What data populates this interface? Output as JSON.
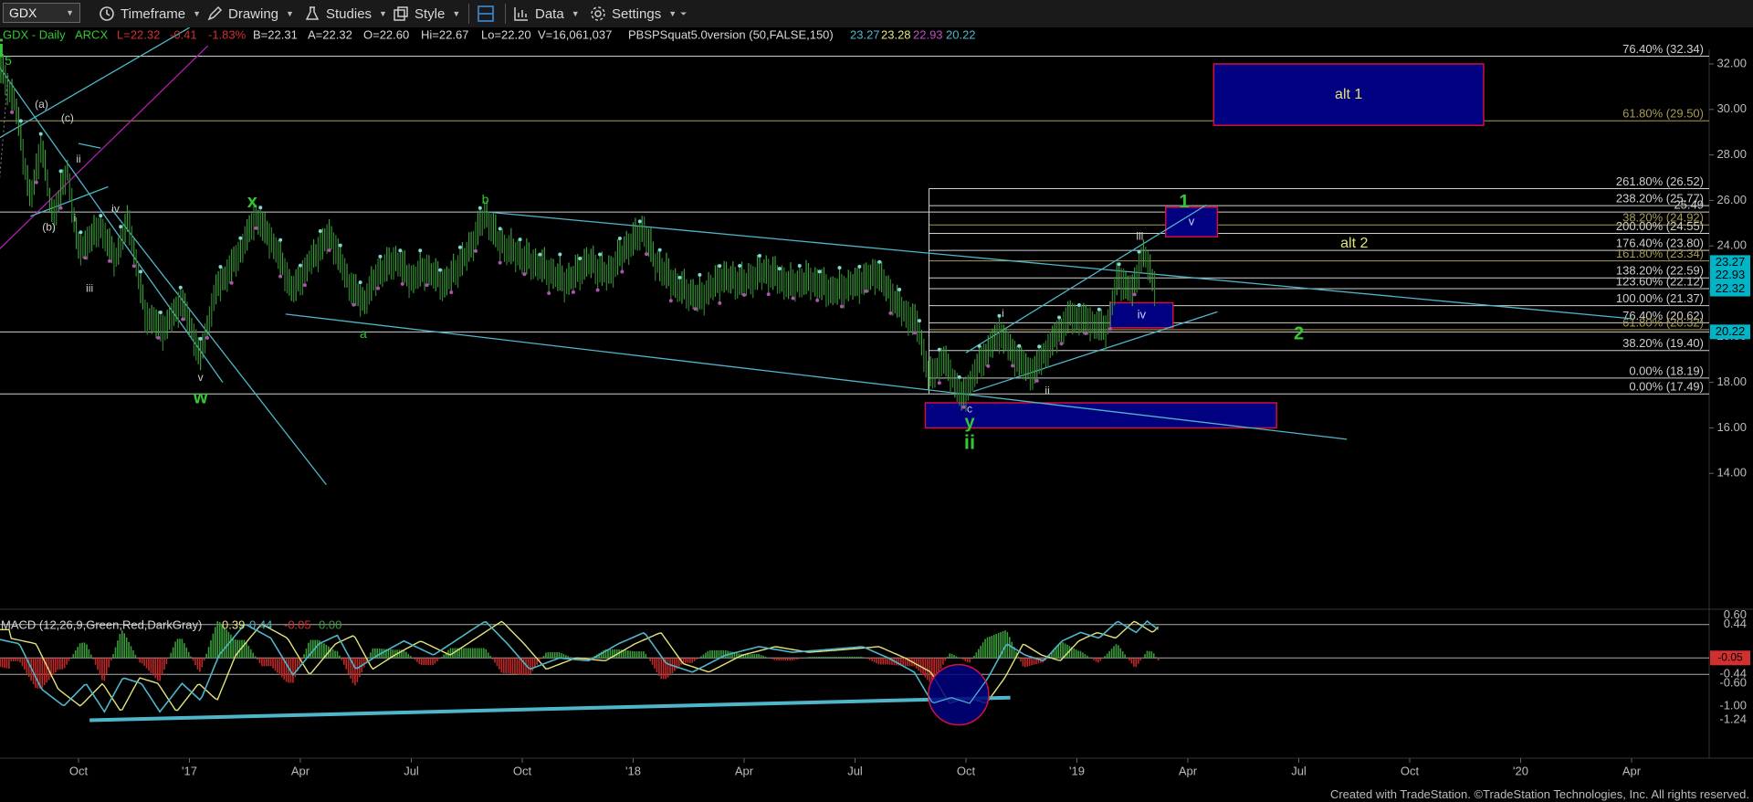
{
  "toolbar": {
    "symbol": "GDX",
    "timeframe": "Timeframe",
    "drawing": "Drawing",
    "studies": "Studies",
    "style": "Style",
    "data": "Data",
    "settings": "Settings"
  },
  "info_bar": {
    "symbol_tf": "GDX - Daily",
    "exchange": "ARCX",
    "last": "L=22.32",
    "change": "-0.41",
    "change_pct": "-1.83%",
    "bid": "B=22.31",
    "ask": "A=22.32",
    "open": "O=22.60",
    "high": "Hi=22.67",
    "low": "Lo=22.20",
    "volume": "V=16,061,037",
    "study": "PBSPSquat5.0version (50,FALSE,150)",
    "v1": "23.27",
    "v2": "23.28",
    "v3": "22.93",
    "v4": "20.22"
  },
  "colors": {
    "bull": "#3a9d3a",
    "bear": "#b050b0",
    "green_label": "#34c734",
    "channel": "#4fb6c9",
    "magenta_line": "#b01fb0",
    "box_fill": "#000080",
    "box_border": "#d01040",
    "fib": "#cfcfcf",
    "fib_gold": "#a89a55",
    "macd_line": "#4fb6c9",
    "signal_line": "#e4e47a",
    "last_price_tag": "#00b4c8"
  },
  "chart_data": {
    "type": "candlestick",
    "title": "GDX - Daily",
    "ylim": [
      13,
      33
    ],
    "y_ticks": [
      "14.00",
      "16.00",
      "18.00",
      "20.00",
      "22.00",
      "24.00",
      "26.00",
      "28.00",
      "30.00",
      "32.00"
    ],
    "x_ticks": [
      {
        "label": "Oct",
        "t": 0.0
      },
      {
        "label": "'17",
        "t": 3.0
      },
      {
        "label": "Apr",
        "t": 6.0
      },
      {
        "label": "Jul",
        "t": 9.0
      },
      {
        "label": "Oct",
        "t": 12.0
      },
      {
        "label": "'18",
        "t": 15.0
      },
      {
        "label": "Apr",
        "t": 18.0
      },
      {
        "label": "Jul",
        "t": 21.0
      },
      {
        "label": "Oct",
        "t": 24.0
      },
      {
        "label": "'19",
        "t": 27.0
      },
      {
        "label": "Apr",
        "t": 30.0
      },
      {
        "label": "Jul",
        "t": 33.0
      },
      {
        "label": "Oct",
        "t": 36.0
      },
      {
        "label": "'20",
        "t": 39.0
      },
      {
        "label": "Apr",
        "t": 42.0
      }
    ],
    "price_path": [
      {
        "t": -2.1,
        "v": 31.8
      },
      {
        "t": -1.7,
        "v": 30.2
      },
      {
        "t": -1.3,
        "v": 26.0
      },
      {
        "t": -1.0,
        "v": 28.5
      },
      {
        "t": -0.7,
        "v": 25.2
      },
      {
        "t": -0.3,
        "v": 27.3
      },
      {
        "t": 0.0,
        "v": 23.8
      },
      {
        "t": 0.6,
        "v": 24.8
      },
      {
        "t": 1.0,
        "v": 23.4
      },
      {
        "t": 1.35,
        "v": 25.2
      },
      {
        "t": 1.8,
        "v": 21.0
      },
      {
        "t": 2.3,
        "v": 20.3
      },
      {
        "t": 2.8,
        "v": 21.6
      },
      {
        "t": 3.3,
        "v": 19.1
      },
      {
        "t": 3.7,
        "v": 22.0
      },
      {
        "t": 4.3,
        "v": 23.5
      },
      {
        "t": 4.8,
        "v": 25.3
      },
      {
        "t": 5.3,
        "v": 24.0
      },
      {
        "t": 5.8,
        "v": 22.0
      },
      {
        "t": 6.3,
        "v": 23.4
      },
      {
        "t": 6.8,
        "v": 24.5
      },
      {
        "t": 7.3,
        "v": 22.4
      },
      {
        "t": 7.7,
        "v": 21.5
      },
      {
        "t": 8.1,
        "v": 22.8
      },
      {
        "t": 8.6,
        "v": 23.4
      },
      {
        "t": 9.0,
        "v": 22.5
      },
      {
        "t": 9.4,
        "v": 23.0
      },
      {
        "t": 9.9,
        "v": 22.3
      },
      {
        "t": 10.5,
        "v": 23.6
      },
      {
        "t": 11.0,
        "v": 25.4
      },
      {
        "t": 11.4,
        "v": 24.1
      },
      {
        "t": 12.0,
        "v": 23.5
      },
      {
        "t": 12.6,
        "v": 23.0
      },
      {
        "t": 13.2,
        "v": 22.4
      },
      {
        "t": 13.8,
        "v": 23.3
      },
      {
        "t": 14.3,
        "v": 22.7
      },
      {
        "t": 14.8,
        "v": 23.9
      },
      {
        "t": 15.3,
        "v": 24.7
      },
      {
        "t": 15.6,
        "v": 23.3
      },
      {
        "t": 16.2,
        "v": 22.2
      },
      {
        "t": 16.8,
        "v": 21.7
      },
      {
        "t": 17.4,
        "v": 22.6
      },
      {
        "t": 18.0,
        "v": 22.4
      },
      {
        "t": 18.6,
        "v": 22.9
      },
      {
        "t": 19.2,
        "v": 22.3
      },
      {
        "t": 19.8,
        "v": 22.5
      },
      {
        "t": 20.4,
        "v": 22.0
      },
      {
        "t": 21.0,
        "v": 22.3
      },
      {
        "t": 21.6,
        "v": 22.8
      },
      {
        "t": 22.2,
        "v": 21.3
      },
      {
        "t": 22.7,
        "v": 20.5
      },
      {
        "t": 23.0,
        "v": 18.2
      },
      {
        "t": 23.4,
        "v": 19.0
      },
      {
        "t": 23.9,
        "v": 17.3
      },
      {
        "t": 24.4,
        "v": 18.9
      },
      {
        "t": 24.9,
        "v": 20.2
      },
      {
        "t": 25.4,
        "v": 19.0
      },
      {
        "t": 25.8,
        "v": 18.4
      },
      {
        "t": 26.3,
        "v": 19.7
      },
      {
        "t": 26.8,
        "v": 20.9
      },
      {
        "t": 27.3,
        "v": 20.7
      },
      {
        "t": 27.8,
        "v": 20.3
      },
      {
        "t": 28.1,
        "v": 22.6
      },
      {
        "t": 28.5,
        "v": 22.0
      },
      {
        "t": 28.8,
        "v": 23.7
      },
      {
        "t": 29.1,
        "v": 22.3
      }
    ],
    "fib_levels": [
      {
        "label": "76.40% (32.34)",
        "value": 32.34,
        "t0": -2.3,
        "color": "fib"
      },
      {
        "label": "61.80% (29.50)",
        "value": 29.5,
        "t0": -2.3,
        "color": "fib_gold"
      },
      {
        "label": "261.80% (26.52)",
        "value": 26.52,
        "t0": 23.0,
        "color": "fib"
      },
      {
        "label": "238.20% (25.77)",
        "value": 25.77,
        "t0": 23.0,
        "color": "fib"
      },
      {
        "label": "25.49",
        "value": 25.49,
        "t0": -2.3,
        "color": "fib"
      },
      {
        "label": "38.20% (24.92)",
        "value": 24.92,
        "t0": 23.0,
        "color": "fib_gold"
      },
      {
        "label": "200.00% (24.55)",
        "value": 24.55,
        "t0": 23.0,
        "color": "fib"
      },
      {
        "label": "176.40% (23.80)",
        "value": 23.8,
        "t0": 23.0,
        "color": "fib"
      },
      {
        "label": "161.80% (23.34)",
        "value": 23.34,
        "t0": 23.0,
        "color": "fib_gold"
      },
      {
        "label": "138.20% (22.59)",
        "value": 22.59,
        "t0": 23.0,
        "color": "fib"
      },
      {
        "label": "123.60% (22.12)",
        "value": 22.12,
        "t0": 23.0,
        "color": "fib"
      },
      {
        "label": "100.00% (21.37)",
        "value": 21.37,
        "t0": 23.0,
        "color": "fib"
      },
      {
        "label": "76.40% (20.62)",
        "value": 20.62,
        "t0": 23.0,
        "color": "fib"
      },
      {
        "label": "61.80% (20.32)",
        "value": 20.32,
        "t0": 23.0,
        "color": "fib_gold"
      },
      {
        "label": "",
        "value": 20.22,
        "t0": -2.3,
        "color": "fib"
      },
      {
        "label": "38.20% (19.40)",
        "value": 19.4,
        "t0": 23.0,
        "color": "fib"
      },
      {
        "label": "0.00% (18.19)",
        "value": 18.19,
        "t0": 23.0,
        "color": "fib"
      },
      {
        "label": "0.00% (17.49)",
        "value": 17.49,
        "t0": -2.3,
        "color": "fib"
      }
    ],
    "boxes": [
      {
        "label": "alt 1",
        "t0": 30.7,
        "t1": 38.0,
        "v0": 29.3,
        "v1": 32.0
      },
      {
        "label": "v",
        "t0": 29.4,
        "t1": 30.8,
        "v0": 24.4,
        "v1": 25.7
      },
      {
        "label": "iv",
        "t0": 27.9,
        "t1": 29.6,
        "v0": 20.4,
        "v1": 21.5
      },
      {
        "label": "",
        "t0": 22.9,
        "t1": 32.4,
        "v0": 16.0,
        "v1": 17.1
      }
    ],
    "wave_labels": [
      {
        "text": "i",
        "t": -2.1,
        "v": 32.6,
        "color": "green_label",
        "size": 28,
        "bold": true
      },
      {
        "text": "5",
        "t": -1.9,
        "v": 32.1,
        "color": "green_label",
        "size": 14
      },
      {
        "text": "(a)",
        "t": -1.0,
        "v": 30.2,
        "color": "fib",
        "size": 12
      },
      {
        "text": "(c)",
        "t": -0.3,
        "v": 29.6,
        "color": "fib",
        "size": 12
      },
      {
        "text": "ii",
        "t": 0.0,
        "v": 27.8,
        "color": "fib",
        "size": 12
      },
      {
        "text": "iv",
        "t": 1.0,
        "v": 25.6,
        "color": "fib",
        "size": 12
      },
      {
        "text": "(b)",
        "t": -0.8,
        "v": 24.8,
        "color": "fib",
        "size": 12
      },
      {
        "text": "i",
        "t": -0.1,
        "v": 25.2,
        "color": "fib",
        "size": 12
      },
      {
        "text": "iii",
        "t": 0.3,
        "v": 22.1,
        "color": "fib",
        "size": 12
      },
      {
        "text": "v",
        "t": 3.3,
        "v": 18.2,
        "color": "fib",
        "size": 12
      },
      {
        "text": "w",
        "t": 3.3,
        "v": 17.3,
        "color": "green_label",
        "size": 20,
        "bold": true
      },
      {
        "text": "x",
        "t": 4.7,
        "v": 25.9,
        "color": "green_label",
        "size": 20,
        "bold": true
      },
      {
        "text": "b",
        "t": 11.0,
        "v": 26.0,
        "color": "green_label",
        "size": 14
      },
      {
        "text": "a",
        "t": 7.7,
        "v": 20.1,
        "color": "green_label",
        "size": 14
      },
      {
        "text": "i",
        "t": 25.0,
        "v": 21.0,
        "color": "fib",
        "size": 12
      },
      {
        "text": "ii",
        "t": 26.2,
        "v": 17.6,
        "color": "fib",
        "size": 12
      },
      {
        "text": "iii",
        "t": 28.7,
        "v": 24.4,
        "color": "fib",
        "size": 12
      },
      {
        "text": "c",
        "t": 24.1,
        "v": 16.8,
        "color": "fib",
        "size": 12
      },
      {
        "text": "y",
        "t": 24.1,
        "v": 16.2,
        "color": "green_label",
        "size": 20,
        "bold": true
      },
      {
        "text": "ii",
        "t": 24.1,
        "v": 15.3,
        "color": "green_label",
        "size": 22,
        "bold": true
      },
      {
        "text": "1",
        "t": 29.9,
        "v": 25.9,
        "color": "green_label",
        "size": 20,
        "bold": true
      },
      {
        "text": "2",
        "t": 33.0,
        "v": 20.1,
        "color": "green_label",
        "size": 20,
        "bold": true
      },
      {
        "text": "alt 2",
        "t": 34.5,
        "v": 24.1,
        "color": "signal_line",
        "size": 16
      }
    ],
    "trend_lines": [
      {
        "t0": -2.3,
        "v0": 28.6,
        "t1": 3.0,
        "v1": 33.6,
        "color": "channel"
      },
      {
        "t0": -2.3,
        "v0": 23.6,
        "t1": 3.5,
        "v1": 32.8,
        "color": "magenta_line"
      },
      {
        "t0": 0.0,
        "v0": 28.5,
        "t1": 0.6,
        "v1": 28.3,
        "color": "channel"
      },
      {
        "t0": -1.3,
        "v0": 25.3,
        "t1": 0.8,
        "v1": 26.6,
        "color": "channel"
      },
      {
        "t0": -2.2,
        "v0": 32.0,
        "t1": 3.9,
        "v1": 18.0,
        "color": "channel"
      },
      {
        "t0": 0.9,
        "v0": 25.6,
        "t1": 6.7,
        "v1": 13.5,
        "color": "channel"
      },
      {
        "t0": 5.6,
        "v0": 21.0,
        "t1": 34.3,
        "v1": 15.5,
        "color": "channel"
      },
      {
        "t0": 11.0,
        "v0": 25.5,
        "t1": 42.0,
        "v1": 20.8,
        "color": "channel"
      },
      {
        "t0": 24.0,
        "v0": 19.3,
        "t1": 30.5,
        "v1": 25.8,
        "color": "channel"
      },
      {
        "t0": 24.2,
        "v0": 17.6,
        "t1": 30.8,
        "v1": 21.1,
        "color": "channel"
      }
    ],
    "axis_tags": [
      {
        "text": "23.27",
        "value": 23.27,
        "bg": "last_price_tag",
        "fg": "#000"
      },
      {
        "text": "22.93",
        "value": 22.7,
        "bg": "last_price_tag",
        "fg": "#000"
      },
      {
        "text": "22.32",
        "value": 22.1,
        "bg": "last_price_tag",
        "fg": "#000"
      },
      {
        "text": "20.22",
        "value": 20.22,
        "bg": "last_price_tag",
        "fg": "#000"
      }
    ]
  },
  "macd": {
    "label": "MACD (12,26,9,Green,Red,DarkGray)",
    "values": [
      "0.39",
      "0.44",
      "-0.05",
      "0.00"
    ],
    "value_colors": [
      "#e4e47a",
      "#4fb6c9",
      "#d03030",
      "#3a9d3a"
    ],
    "ylim": [
      -1.4,
      0.8
    ],
    "y_ticks": [
      "0.60",
      "0.44",
      "-0.15",
      "-0.44",
      "-0.60",
      "-1.00",
      "-1.24"
    ],
    "y_tick_values": [
      0.6,
      0.44,
      -0.15,
      -0.44,
      -0.6,
      -1.0,
      -1.24
    ],
    "ref_levels": [
      0.44,
      -0.15,
      -0.44
    ],
    "macd_path": [
      {
        "t": -2.3,
        "v": 0.2
      },
      {
        "t": -1.6,
        "v": 0.1
      },
      {
        "t": -1.0,
        "v": -0.7
      },
      {
        "t": -0.4,
        "v": -1.0
      },
      {
        "t": 0.2,
        "v": -0.6
      },
      {
        "t": 0.7,
        "v": -1.1
      },
      {
        "t": 1.2,
        "v": -0.5
      },
      {
        "t": 1.7,
        "v": -0.6
      },
      {
        "t": 2.2,
        "v": -1.1
      },
      {
        "t": 2.8,
        "v": -0.6
      },
      {
        "t": 3.3,
        "v": -0.9
      },
      {
        "t": 3.8,
        "v": -0.1
      },
      {
        "t": 4.5,
        "v": 0.45
      },
      {
        "t": 5.2,
        "v": 0.2
      },
      {
        "t": 5.8,
        "v": -0.45
      },
      {
        "t": 6.5,
        "v": 0.1
      },
      {
        "t": 7.0,
        "v": 0.25
      },
      {
        "t": 7.5,
        "v": -0.35
      },
      {
        "t": 8.1,
        "v": -0.1
      },
      {
        "t": 8.8,
        "v": 0.15
      },
      {
        "t": 9.6,
        "v": -0.1
      },
      {
        "t": 10.3,
        "v": 0.2
      },
      {
        "t": 11.0,
        "v": 0.5
      },
      {
        "t": 11.6,
        "v": 0.1
      },
      {
        "t": 12.2,
        "v": -0.35
      },
      {
        "t": 13.0,
        "v": -0.15
      },
      {
        "t": 13.8,
        "v": -0.2
      },
      {
        "t": 14.6,
        "v": 0.1
      },
      {
        "t": 15.3,
        "v": 0.3
      },
      {
        "t": 15.9,
        "v": -0.25
      },
      {
        "t": 16.6,
        "v": -0.4
      },
      {
        "t": 17.5,
        "v": -0.1
      },
      {
        "t": 18.4,
        "v": 0.05
      },
      {
        "t": 19.3,
        "v": -0.05
      },
      {
        "t": 20.3,
        "v": 0.0
      },
      {
        "t": 21.2,
        "v": 0.05
      },
      {
        "t": 21.9,
        "v": -0.15
      },
      {
        "t": 22.6,
        "v": -0.4
      },
      {
        "t": 23.1,
        "v": -0.95
      },
      {
        "t": 23.6,
        "v": -0.85
      },
      {
        "t": 24.1,
        "v": -0.95
      },
      {
        "t": 24.6,
        "v": -0.5
      },
      {
        "t": 25.1,
        "v": 0.1
      },
      {
        "t": 25.6,
        "v": -0.1
      },
      {
        "t": 26.1,
        "v": -0.2
      },
      {
        "t": 26.6,
        "v": 0.15
      },
      {
        "t": 27.1,
        "v": 0.3
      },
      {
        "t": 27.6,
        "v": 0.2
      },
      {
        "t": 28.1,
        "v": 0.5
      },
      {
        "t": 28.6,
        "v": 0.3
      },
      {
        "t": 28.9,
        "v": 0.5
      },
      {
        "t": 29.2,
        "v": 0.35
      }
    ],
    "trend_line": {
      "t0": 0.3,
      "v0": -1.25,
      "t1": 25.2,
      "v1": -0.85
    },
    "circle": {
      "t": 23.8,
      "v": -0.8
    }
  },
  "footer": "Created with TradeStation. ©TradeStation Technologies, Inc. All rights reserved."
}
